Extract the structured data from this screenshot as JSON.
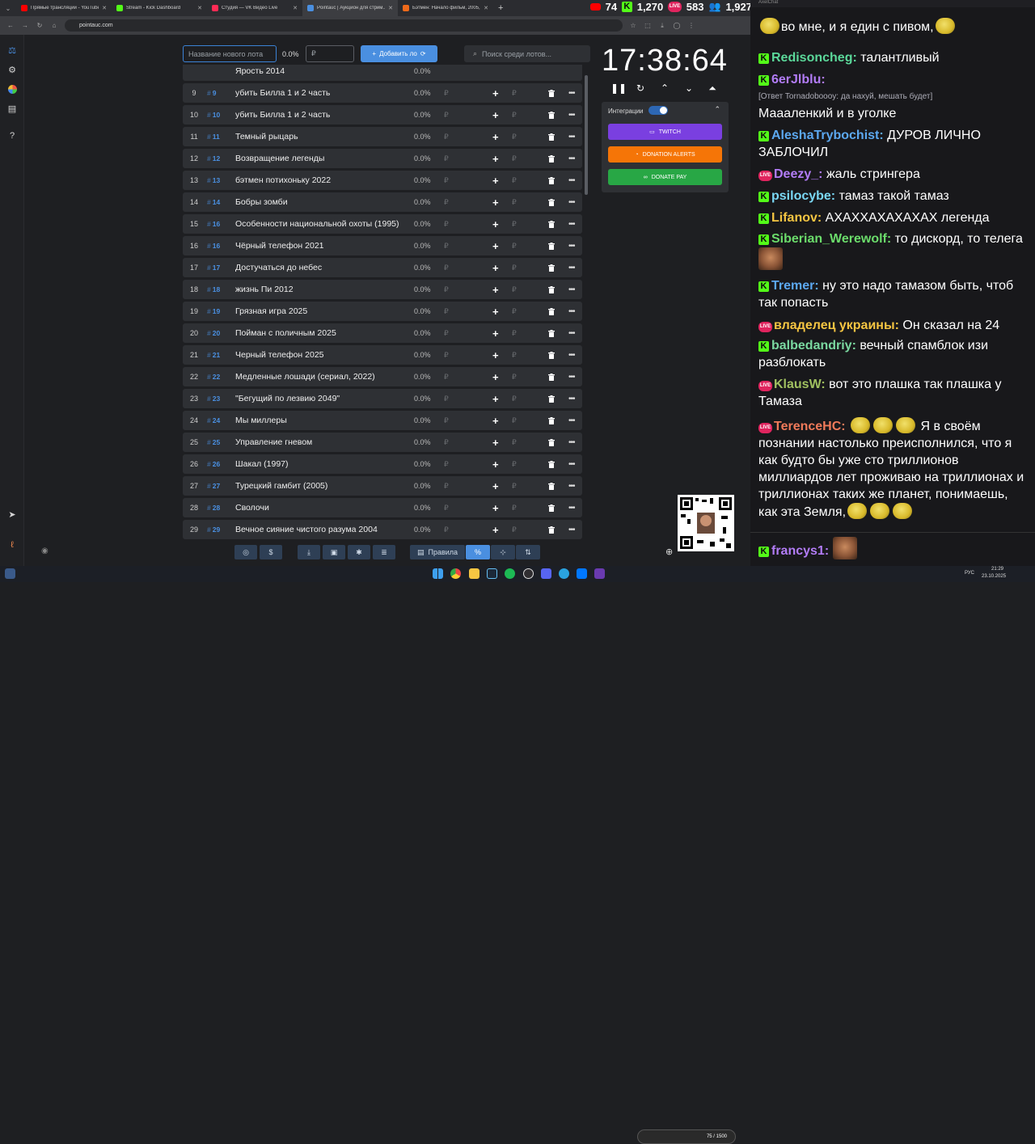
{
  "browser": {
    "tabs": [
      {
        "title": "Прямые трансляции - YouTube",
        "color": "#ff0000"
      },
      {
        "title": "Stream - Kick Dashboard",
        "color": "#53fc18"
      },
      {
        "title": "Студия — VK Видео Live",
        "color": "#ff2b55"
      },
      {
        "title": "Pointauc | Аукцион для стрим...",
        "color": "#4a8fe0"
      },
      {
        "title": "Бэтмен: Начало фильм, 2005, ...",
        "color": "#f06a1a"
      }
    ],
    "new_tab": "+",
    "url": "pointauc.com",
    "viewers": [
      {
        "platform": "youtube",
        "count": "74",
        "color": "#ff0000"
      },
      {
        "platform": "kick",
        "count": "1,270",
        "color": "#53fc18"
      },
      {
        "platform": "vk",
        "count": "583",
        "color": "#e0245e"
      },
      {
        "platform": "total",
        "count": "1,927",
        "color": "#ffffff"
      }
    ]
  },
  "app": {
    "lot_name_placeholder": "Название нового лота",
    "percent": "0.0%",
    "amount_placeholder": "₽",
    "add_button": "Добавить ло",
    "search_placeholder": "Поиск среди лотов...",
    "first_partial_row": "Ярость 2014",
    "lots": [
      {
        "n": "9",
        "id": "9",
        "name": "убить Билла 1 и 2 часть",
        "pct": "0.0%",
        "cur": "₽"
      },
      {
        "n": "10",
        "id": "10",
        "name": "убить Билла 1 и 2 часть",
        "pct": "0.0%",
        "cur": "₽"
      },
      {
        "n": "11",
        "id": "11",
        "name": "Темный рыцарь",
        "pct": "0.0%",
        "cur": "₽"
      },
      {
        "n": "12",
        "id": "12",
        "name": "Возвращение легенды",
        "pct": "0.0%",
        "cur": "₽"
      },
      {
        "n": "13",
        "id": "13",
        "name": "бэтмен потихоньку 2022",
        "pct": "0.0%",
        "cur": "₽"
      },
      {
        "n": "14",
        "id": "14",
        "name": "Бобры зомби",
        "pct": "0.0%",
        "cur": "₽"
      },
      {
        "n": "15",
        "id": "16",
        "name": "Особенности национальной охоты (1995)",
        "pct": "0.0%",
        "cur": "₽"
      },
      {
        "n": "16",
        "id": "16",
        "name": "Чёрный телефон 2021",
        "pct": "0.0%",
        "cur": "₽"
      },
      {
        "n": "17",
        "id": "17",
        "name": "Достучаться до небес",
        "pct": "0.0%",
        "cur": "₽"
      },
      {
        "n": "18",
        "id": "18",
        "name": "жизнь Пи 2012",
        "pct": "0.0%",
        "cur": "₽"
      },
      {
        "n": "19",
        "id": "19",
        "name": "Грязная игра 2025",
        "pct": "0.0%",
        "cur": "₽"
      },
      {
        "n": "20",
        "id": "20",
        "name": "Пойман с поличным 2025",
        "pct": "0.0%",
        "cur": "₽"
      },
      {
        "n": "21",
        "id": "21",
        "name": "Черный телефон 2025",
        "pct": "0.0%",
        "cur": "₽"
      },
      {
        "n": "22",
        "id": "22",
        "name": "Медленные лошади (сериал, 2022)",
        "pct": "0.0%",
        "cur": "₽"
      },
      {
        "n": "23",
        "id": "23",
        "name": "\"Бегущий по лезвию 2049\"",
        "pct": "0.0%",
        "cur": "₽"
      },
      {
        "n": "24",
        "id": "24",
        "name": "Мы миллеры",
        "pct": "0.0%",
        "cur": "₽"
      },
      {
        "n": "25",
        "id": "25",
        "name": "Управление гневом",
        "pct": "0.0%",
        "cur": "₽"
      },
      {
        "n": "26",
        "id": "26",
        "name": "Шакал (1997)",
        "pct": "0.0%",
        "cur": "₽"
      },
      {
        "n": "27",
        "id": "27",
        "name": "Турецкий гамбит (2005)",
        "pct": "0.0%",
        "cur": "₽"
      },
      {
        "n": "28",
        "id": "28",
        "name": "Сволочи",
        "pct": "0.0%",
        "cur": "₽"
      },
      {
        "n": "29",
        "id": "29",
        "name": "Вечное сияние чистого разума 2004",
        "pct": "0.0%",
        "cur": "₽"
      }
    ],
    "timer": "17:38:64",
    "integrations_label": "Интеграции",
    "integration_buttons": [
      {
        "label": "TWITCH",
        "color": "#7a3fe0"
      },
      {
        "label": "DONATION ALERTS",
        "color": "#f57507"
      },
      {
        "label": "DONATE PAY",
        "color": "#28a745"
      }
    ],
    "toolbar": {
      "rules_label": "Правила",
      "percent_label": "%",
      "currency_label": "$"
    }
  },
  "chat": {
    "header": "AxelChat",
    "messages": [
      {
        "platform": "kick",
        "user": "",
        "color": "#ffffff",
        "text": "во мне, и я един с пивом,"
      },
      {
        "platform": "kick",
        "user": "Redisoncheg:",
        "color": "#5bd89a",
        "text": "талантливый"
      },
      {
        "platform": "kick",
        "user": "6erJlblu:",
        "color": "#b27cf6",
        "reply": "[Ответ Tornadoboooy: да нахуй, мешать будет]",
        "text": "Маааленкий и в уголке"
      },
      {
        "platform": "kick",
        "user": "AleshaTrybochist:",
        "color": "#5ca8f0",
        "text": "ДУРОВ ЛИЧНО ЗАБЛОЧИЛ"
      },
      {
        "platform": "vk",
        "user": "Deezy_:",
        "color": "#b27cf6",
        "text": "жаль стрингера"
      },
      {
        "platform": "kick",
        "user": "psilocybe:",
        "color": "#7ad8f5",
        "text": "тамаз такой тамаз"
      },
      {
        "platform": "kick",
        "user": "Lifanov:",
        "color": "#f5c542",
        "text": "АХАХХАХАХАХАХ легенда"
      },
      {
        "platform": "kick",
        "user": "Siberian_Werewolf:",
        "color": "#6bdc6b",
        "text": "то дискорд, то телега"
      },
      {
        "platform": "kick",
        "user": "Tremer:",
        "color": "#5ca8f0",
        "text": "ну это надо тамазом быть, чтоб так попасть"
      },
      {
        "platform": "vk",
        "user": "владелец украины:",
        "color": "#f5c542",
        "text": "Он сказал на 24"
      },
      {
        "platform": "kick",
        "user": "balbedandriy:",
        "color": "#7ad8a0",
        "text": "вечный спамблок изи разблокать"
      },
      {
        "platform": "vk",
        "user": "KlausW:",
        "color": "#a0c060",
        "text": "вот это плашка так плашка у Тамаза"
      },
      {
        "platform": "vk",
        "user": "TerenceHC:",
        "color": "#f07a5a",
        "text": "Я в своём познании настолько преисполнился, что я как будто бы уже сто триллионов миллиардов лет проживаю на триллионах и триллионах таких же планет, понимаешь, как эта Земля,"
      },
      {
        "platform": "kick",
        "user": "francys1:",
        "color": "#b27cf6",
        "text": ""
      }
    ]
  },
  "taskbar": {
    "lang": "РУС",
    "time": "21:29",
    "date": "23.10.2025",
    "widget": "75 / 1500"
  },
  "colors": {
    "accent": "#4a8fe0",
    "row_bg": "#2e3034",
    "kick_green": "#53fc18",
    "vk_red": "#e0245e"
  }
}
